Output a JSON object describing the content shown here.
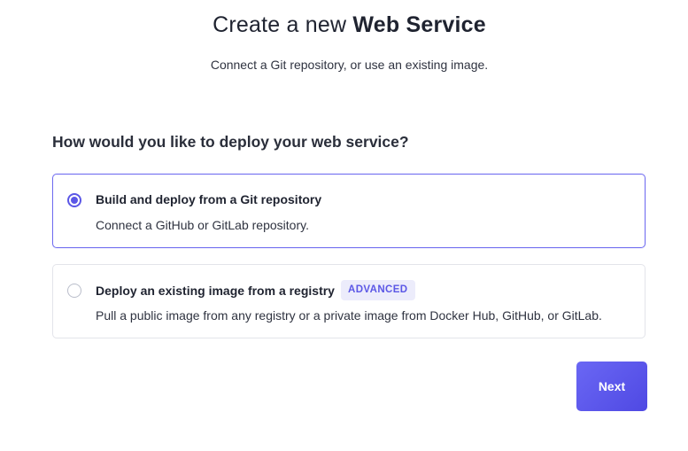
{
  "header": {
    "title_prefix": "Create a new ",
    "title_strong": "Web Service",
    "subtitle": "Connect a Git repository, or use an existing image."
  },
  "question": "How would you like to deploy your web service?",
  "options": [
    {
      "title": "Build and deploy from a Git repository",
      "description": "Connect a GitHub or GitLab repository.",
      "selected": true
    },
    {
      "title": "Deploy an existing image from a registry",
      "badge": "ADVANCED",
      "description": "Pull a public image from any registry or a private image from Docker Hub, GitHub, or GitLab.",
      "selected": false
    }
  ],
  "actions": {
    "next_label": "Next"
  },
  "colors": {
    "accent": "#5b57e6",
    "badge_bg": "#ececfb",
    "selected_border": "#6f6cf0"
  }
}
